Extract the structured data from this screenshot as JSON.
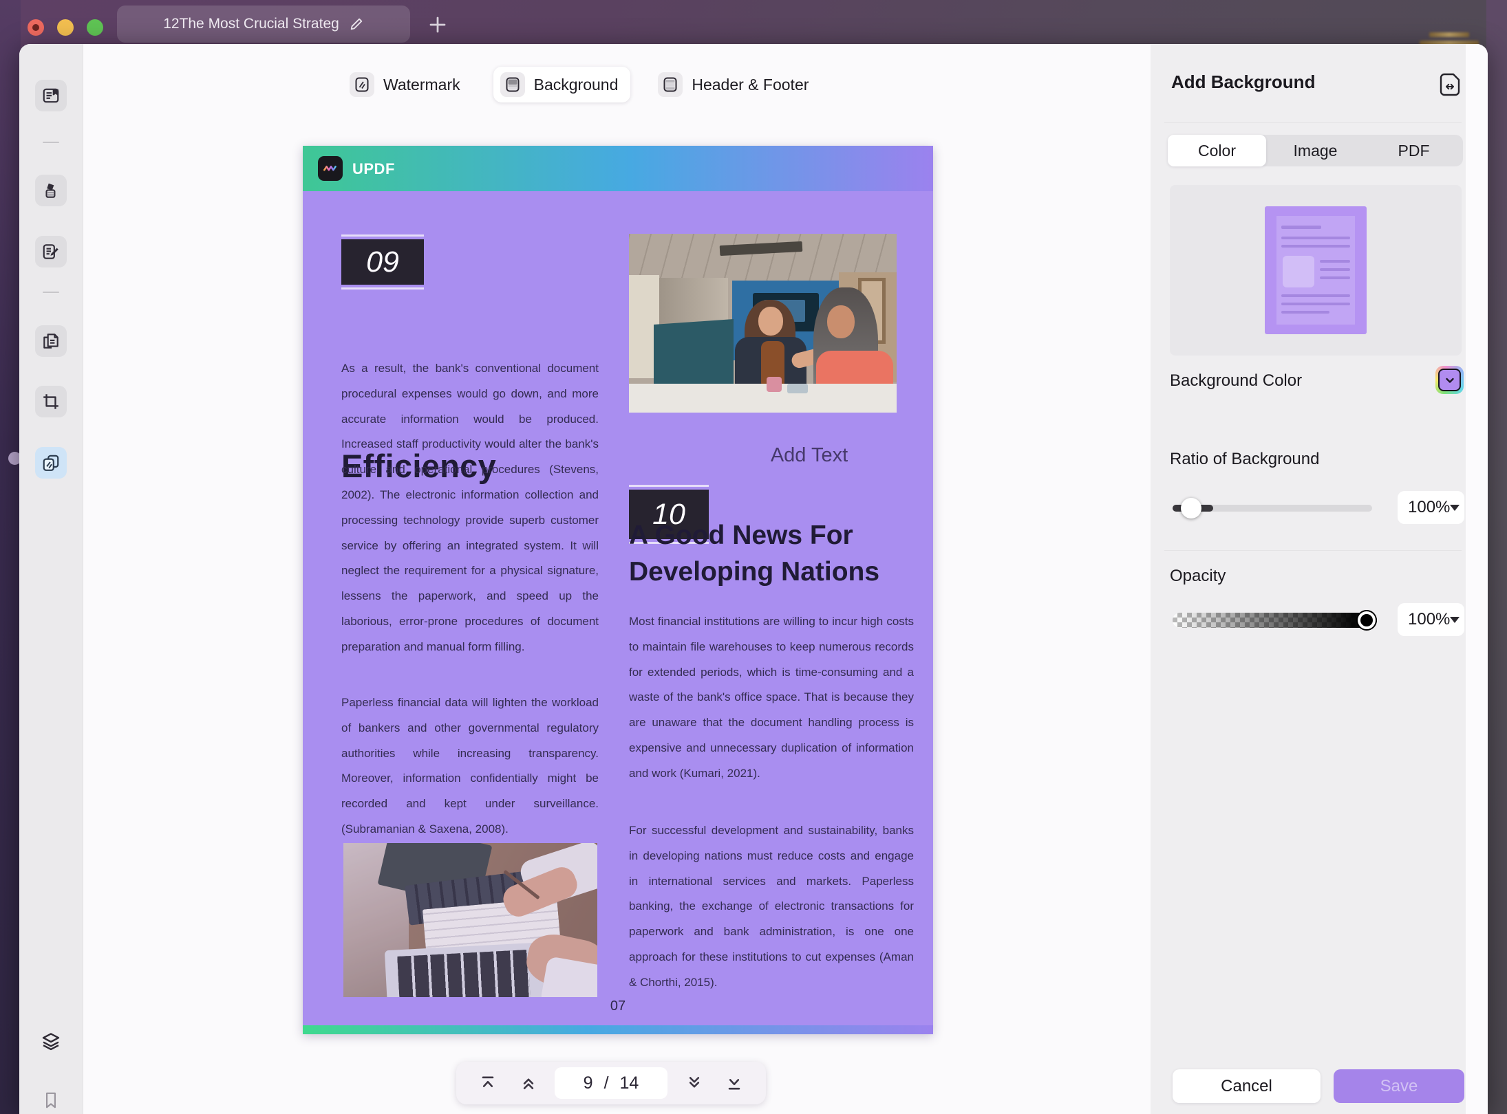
{
  "window": {
    "tab_title": "12The Most Crucial Strateg",
    "traffic_lights": [
      "close",
      "minimize",
      "zoom"
    ]
  },
  "toolbar": {
    "items": [
      {
        "label": "Watermark",
        "selected": false
      },
      {
        "label": "Background",
        "selected": true
      },
      {
        "label": "Header & Footer",
        "selected": false
      }
    ]
  },
  "sidebar": {
    "icons": [
      "reader",
      "highlighter",
      "edit-note",
      "organize-pages",
      "crop",
      "watermark-tools",
      "layers",
      "bookmark"
    ],
    "selected": "watermark-tools"
  },
  "document": {
    "brand": "UPDF",
    "page_footer_number": "07",
    "left_column": {
      "chapter_number": "09",
      "chapter_title": "Efficiency",
      "para1": "As a result, the bank's conventional document procedural expenses would go down, and more accurate information would be produced. Increased staff productivity would alter the bank's culture and operational procedures (Stevens, 2002). The electronic information collection and processing technology provide superb customer service by offering an integrated system. It will neglect the requirement for a physical signature, lessens the paperwork, and speed up the laborious, error-prone procedures of document preparation and manual form filling.",
      "para2": "Paperless financial data will lighten the workload of bankers and other governmental regulatory authorities while increasing transparency. Moreover, information confidentially might be recorded and kept under surveillance. (Subramanian & Saxena, 2008)."
    },
    "right_column": {
      "chapter_number": "10",
      "add_text_label": "Add Text",
      "chapter_title": "A Good News For Developing Nations",
      "para1": "Most financial institutions are willing to incur high costs to maintain file warehouses to keep numerous records for extended periods, which is time-consuming and a waste of the bank's office space. That is because they are unaware that the document handling process is expensive and unnecessary duplication of information and work (Kumari, 2021).",
      "para2": "For successful development and sustainability, banks in developing nations must reduce costs and engage in international services and markets. Paperless banking, the exchange of electronic transactions for paperwork and bank administration, is one one approach for these institutions to cut expenses (Aman & Chorthi, 2015)."
    }
  },
  "pagination": {
    "current": "9",
    "separator": "/",
    "total": "14"
  },
  "panel": {
    "title": "Add Background",
    "tabs": [
      {
        "label": "Color",
        "selected": true
      },
      {
        "label": "Image",
        "selected": false
      },
      {
        "label": "PDF",
        "selected": false
      }
    ],
    "background_color_label": "Background Color",
    "ratio_label": "Ratio of Background",
    "ratio_value": "100%",
    "ratio_slider_percent": 20,
    "opacity_label": "Opacity",
    "opacity_value": "100%",
    "opacity_slider_percent": 100,
    "cancel_label": "Cancel",
    "save_label": "Save"
  },
  "colors": {
    "page_background": "#a98ef0",
    "swatch_purple": "#b18cf0",
    "save_button": "#a584ea",
    "accent_gradient": [
      "#3fc795",
      "#47a9e2",
      "#9b82ee"
    ],
    "selected_tile_blue": "#cfe4f7"
  },
  "icons": {
    "collapse-panel-icon": "page with left-right arrow",
    "first-page-icon": "bar over chevron up",
    "prev-page-icon": "double chevron up",
    "next-page-icon": "double chevron down",
    "last-page-icon": "chevron down over bar",
    "color-swatch-chevron-icon": "chevron down"
  }
}
